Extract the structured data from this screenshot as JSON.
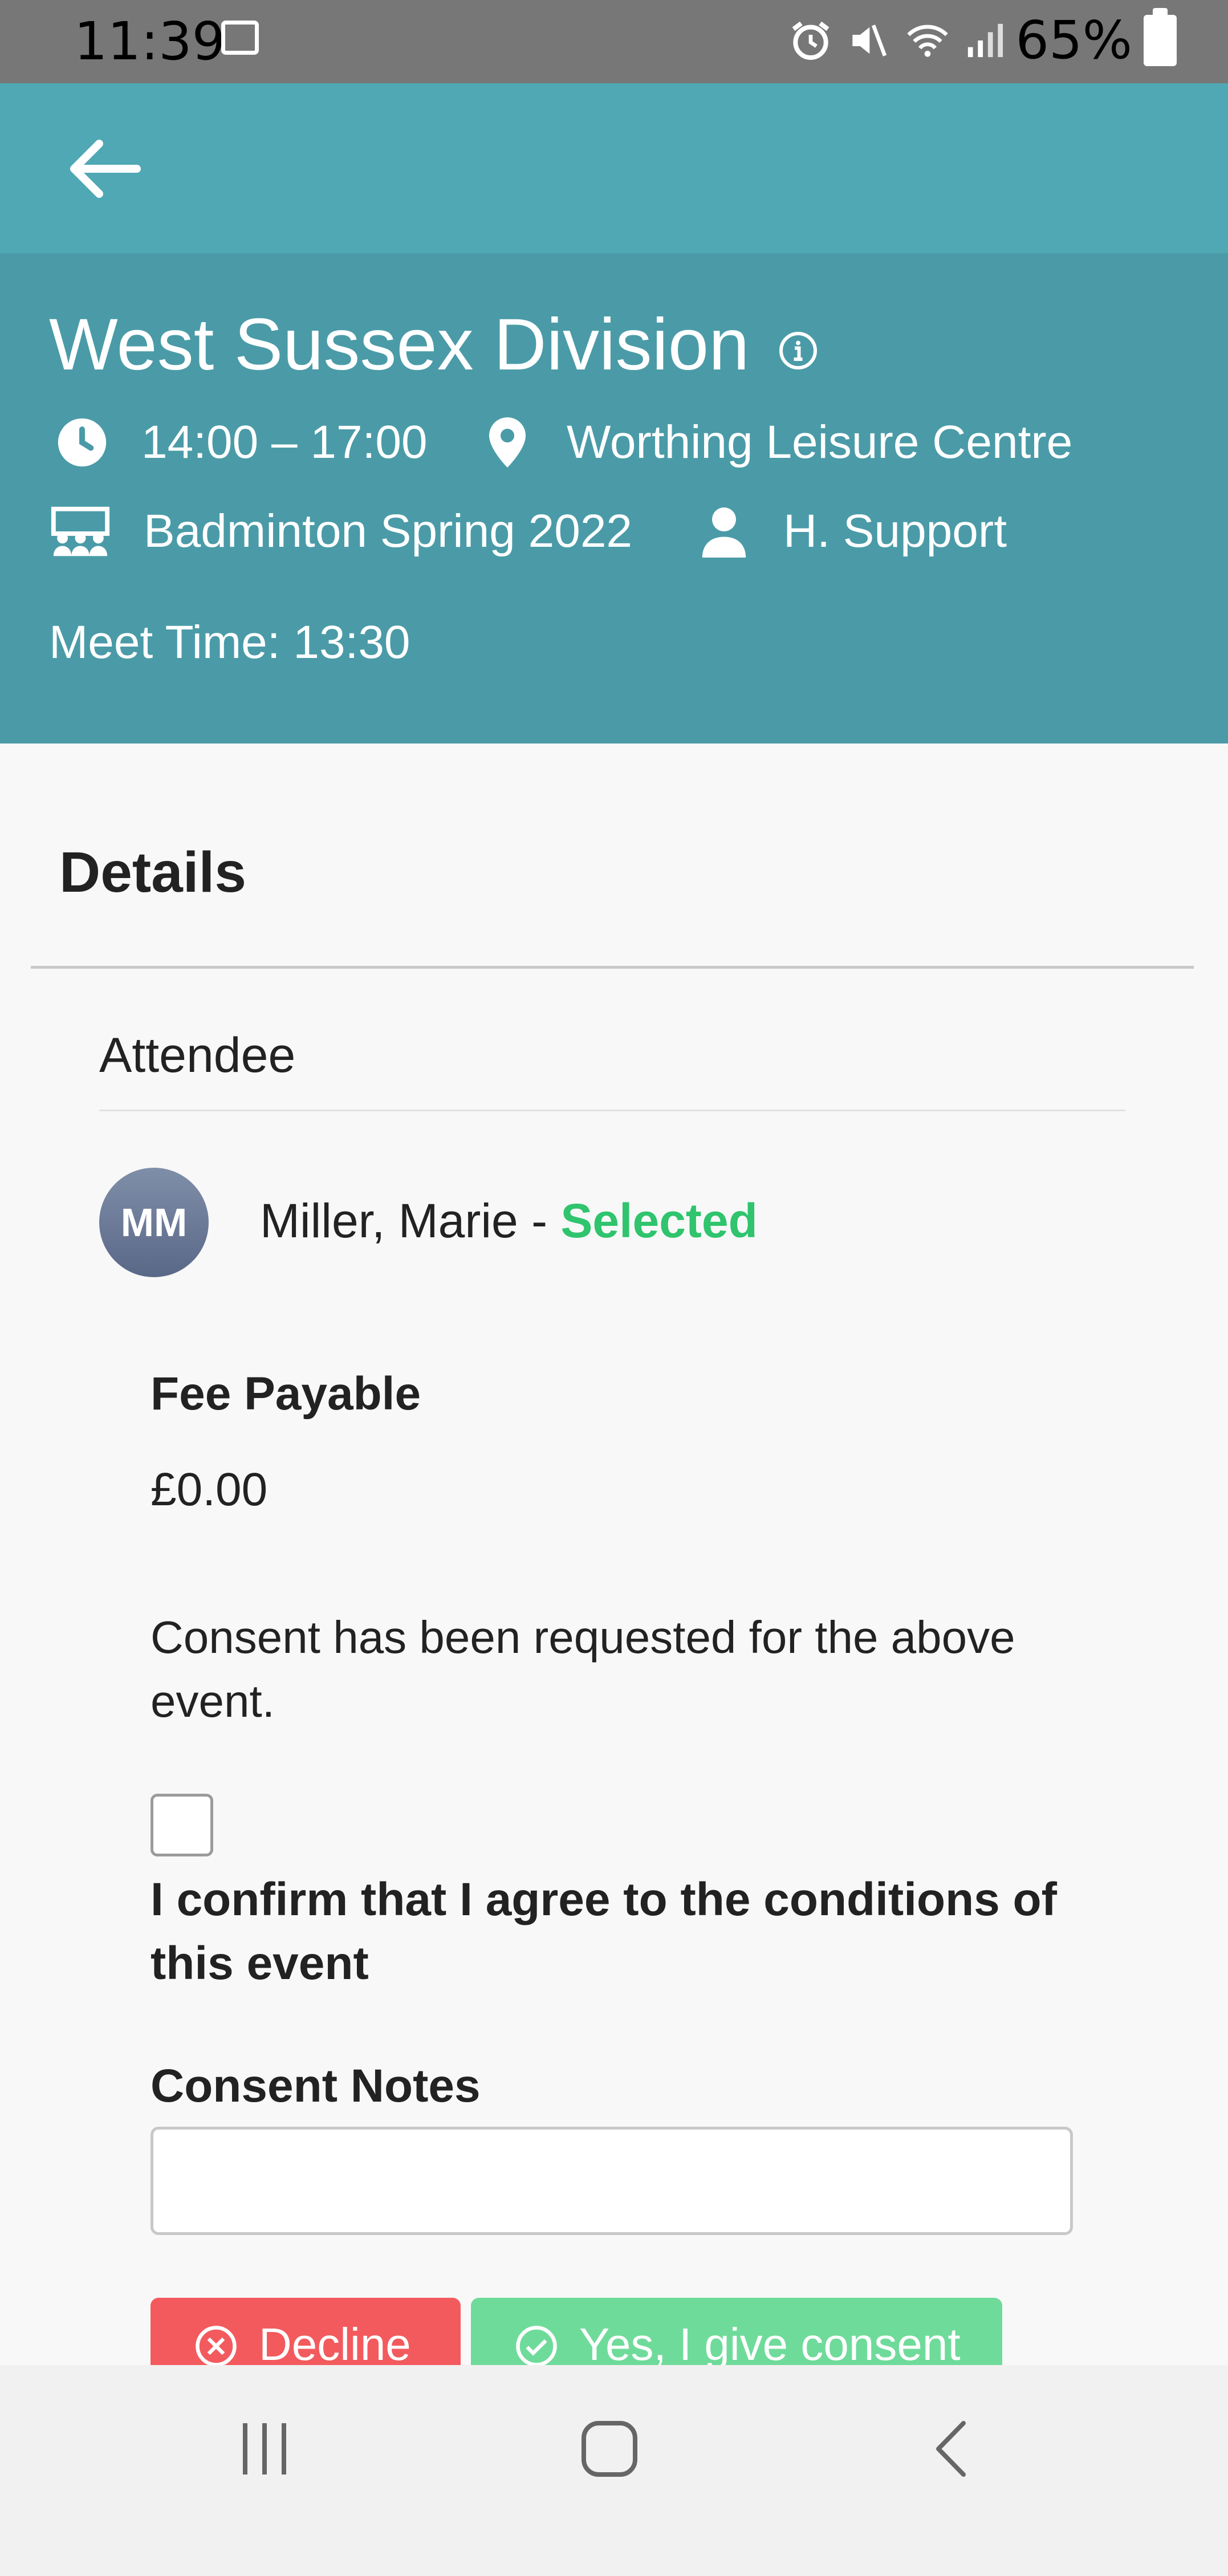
{
  "status_bar": {
    "time": "11:39",
    "battery": "65%"
  },
  "header": {
    "title": "West Sussex Division",
    "time_range": "14:00 – 17:00",
    "location": "Worthing Leisure Centre",
    "group": "Badminton Spring 2022",
    "organiser": "H. Support",
    "meet_time": "Meet Time: 13:30"
  },
  "details": {
    "title": "Details",
    "attendee_label": "Attendee",
    "attendee": {
      "initials": "MM",
      "name": "Miller, Marie",
      "separator": " - ",
      "status": "Selected"
    },
    "fee_label": "Fee Payable",
    "fee_value": "£0.00",
    "consent_text": "Consent has been requested for the above event.",
    "confirm_text": "I confirm that I agree to the conditions of this event",
    "notes_label": "Consent Notes",
    "notes_value": "",
    "decline_label": "Decline",
    "consent_label": "Yes, I give consent"
  },
  "colors": {
    "app_bar": "#4fa8b4",
    "header": "#4a9ba7",
    "selected": "#2fc46d",
    "decline": "#f35a5e",
    "consent": "#6fdb9a"
  }
}
